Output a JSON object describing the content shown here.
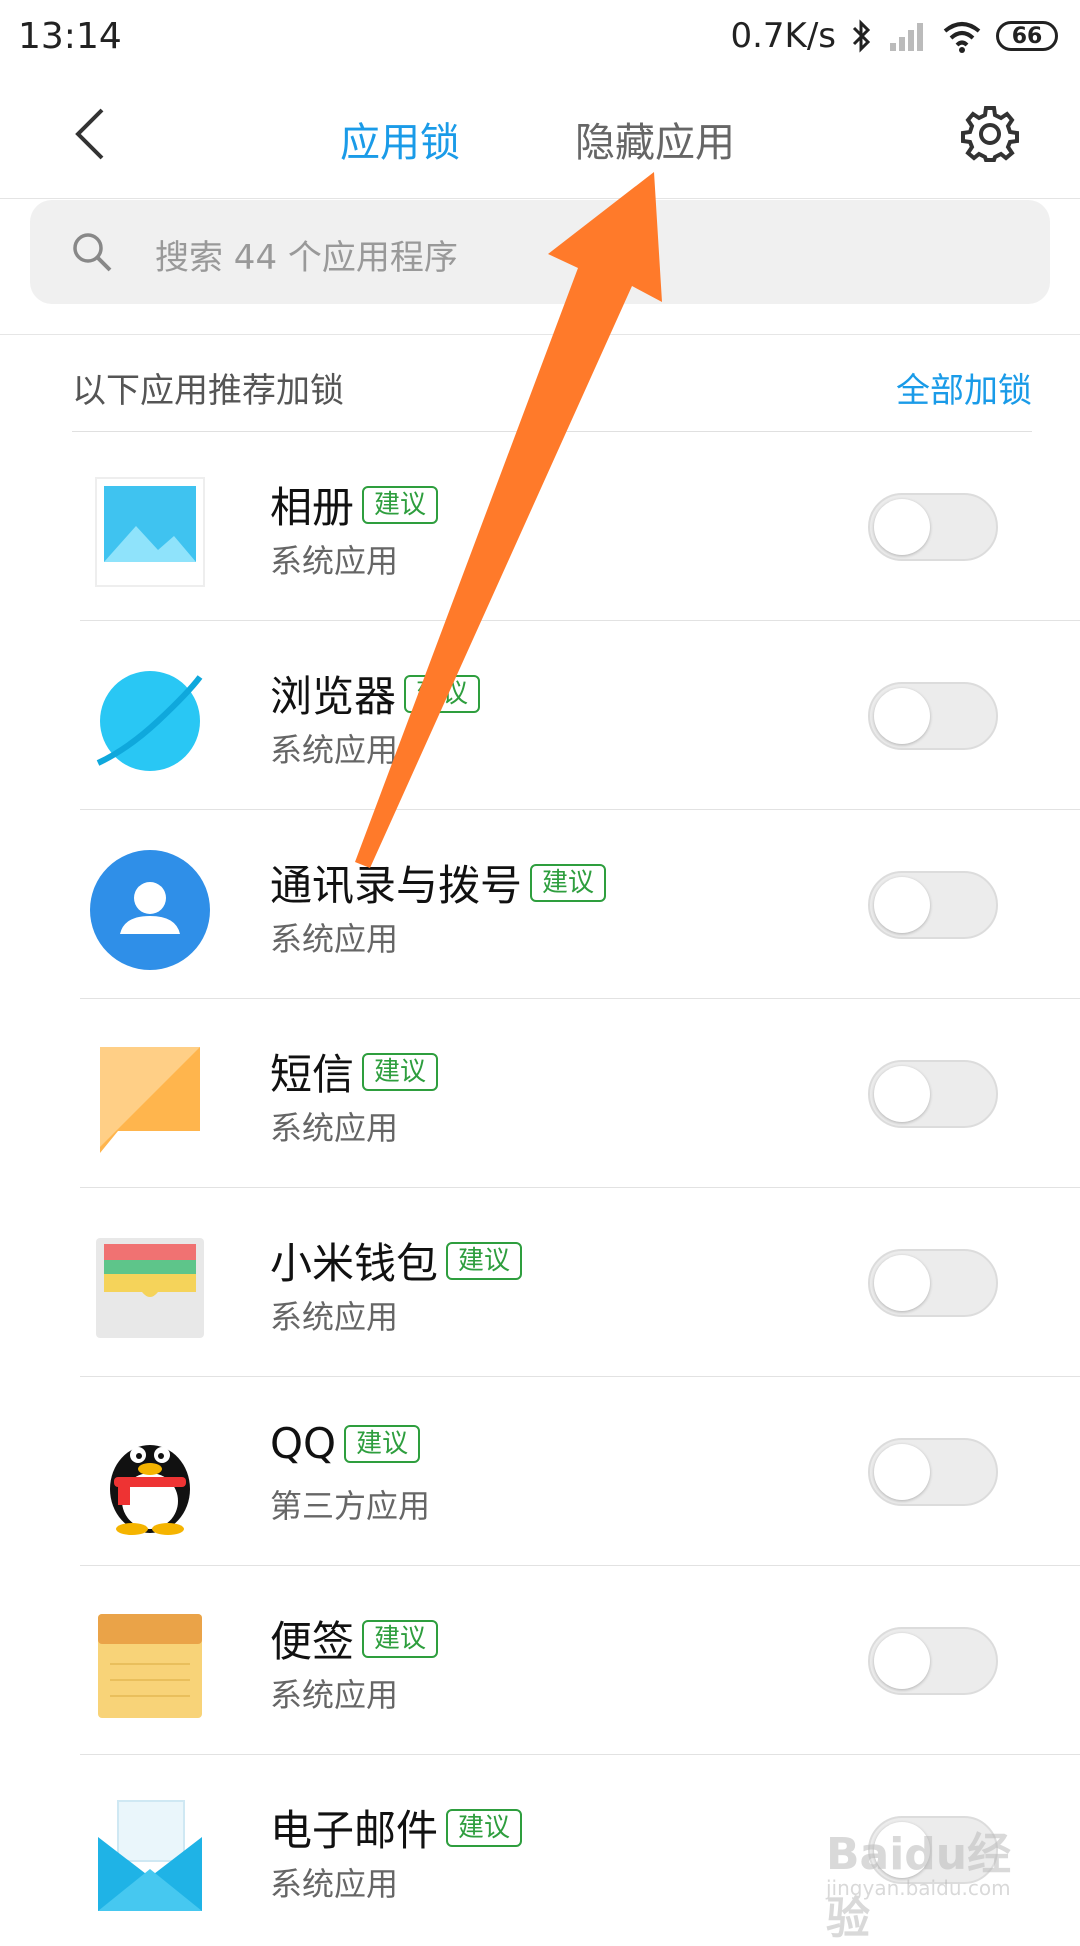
{
  "status": {
    "time": "13:14",
    "net_speed": "0.7K/s",
    "battery": "66"
  },
  "header": {
    "tab_lock": "应用锁",
    "tab_hide": "隐藏应用"
  },
  "search": {
    "placeholder": "搜索 44 个应用程序"
  },
  "section": {
    "title": "以下应用推荐加锁",
    "lock_all": "全部加锁"
  },
  "apps": [
    {
      "name": "相册",
      "tag": "建议",
      "type": "系统应用",
      "icon": "gallery-icon"
    },
    {
      "name": "浏览器",
      "tag": "建议",
      "type": "系统应用",
      "icon": "browser-icon"
    },
    {
      "name": "通讯录与拨号",
      "tag": "建议",
      "type": "系统应用",
      "icon": "contacts-icon"
    },
    {
      "name": "短信",
      "tag": "建议",
      "type": "系统应用",
      "icon": "messages-icon"
    },
    {
      "name": "小米钱包",
      "tag": "建议",
      "type": "系统应用",
      "icon": "wallet-icon"
    },
    {
      "name": "QQ",
      "tag": "建议",
      "type": "第三方应用",
      "icon": "qq-icon"
    },
    {
      "name": "便签",
      "tag": "建议",
      "type": "系统应用",
      "icon": "notes-icon"
    },
    {
      "name": "电子邮件",
      "tag": "建议",
      "type": "系统应用",
      "icon": "email-icon"
    }
  ],
  "watermark": {
    "brand": "Baidu经验",
    "url": "jingyan.baidu.com"
  },
  "colors": {
    "accent": "#1a9be8",
    "tag_green": "#2e9e3e",
    "arrow": "#ff7a2a"
  }
}
